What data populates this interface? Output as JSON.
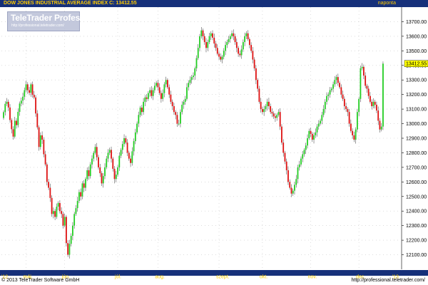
{
  "header": {
    "title": "DOW JONES INDUSTRIAL AVERAGE INDEX",
    "close_label": "C: 13412.55",
    "period": "naponta"
  },
  "logo": {
    "name": "TeleTrader Professional",
    "url": "http://professional.teletrader.com/"
  },
  "footer": {
    "copyright": "© 2013 TeleTrader Software GmbH",
    "url": "http://professional.teletrader.com/"
  },
  "colors": {
    "up": "#22cc22",
    "down": "#dd1111",
    "bar": "#16307a",
    "axis_text": "#ffcc00",
    "last_price_bg": "#ffff00"
  },
  "chart_data": {
    "type": "candlestick",
    "title": "DOW JONES INDUSTRIAL AVERAGE INDEX",
    "last_value": 13412.55,
    "last_label": "13412.55",
    "ylim": [
      12000,
      13800
    ],
    "y_ticks": [
      12100,
      12200,
      12300,
      12400,
      12500,
      12600,
      12700,
      12800,
      12900,
      13000,
      13100,
      13200,
      13300,
      13400,
      13500,
      13600,
      13700
    ],
    "y_tick_labels": [
      "12100.00",
      "12200.00",
      "12300.00",
      "12400.00",
      "12500.00",
      "12600.00",
      "12700.00",
      "12800.00",
      "12900.00",
      "13000.00",
      "13100.00",
      "13200.00",
      "13300.00",
      "13400.00",
      "13500.00",
      "13600.00",
      "13700.00"
    ],
    "x_axis_labels": [
      "'12",
      "máj.",
      "jún.",
      "júl.",
      "aug.",
      "szept.",
      "okt.",
      "nov.",
      "dec.",
      "'13"
    ],
    "x_axis_positions": [
      0,
      14,
      38,
      71,
      96,
      134,
      161,
      191,
      221,
      243
    ],
    "x_count": 248,
    "grid": "dotted",
    "close": [
      13079,
      13136,
      13150,
      13111,
      13025,
      12962,
      12911,
      13020,
      12990,
      13081,
      13138,
      13158,
      13185,
      13230,
      13270,
      13230,
      13212,
      13270,
      13198,
      13180,
      13070,
      12975,
      12840,
      12920,
      12890,
      12790,
      12720,
      12600,
      12560,
      12490,
      12380,
      12400,
      12360,
      12430,
      12455,
      12400,
      12380,
      12300,
      12360,
      12180,
      12100,
      12175,
      12230,
      12300,
      12380,
      12420,
      12470,
      12530,
      12500,
      12590,
      12560,
      12620,
      12680,
      12640,
      12720,
      12760,
      12800,
      12840,
      12770,
      12700,
      12660,
      12590,
      12640,
      12700,
      12760,
      12800,
      12820,
      12760,
      12690,
      12620,
      12650,
      12700,
      12780,
      12820,
      12860,
      12900,
      12870,
      12800,
      12760,
      12730,
      12810,
      12880,
      12940,
      13000,
      13060,
      13110,
      13080,
      13150,
      13180,
      13170,
      13210,
      13230,
      13190,
      13230,
      13260,
      13280,
      13250,
      13210,
      13170,
      13210,
      13270,
      13300,
      13250,
      13200,
      13150,
      13120,
      13080,
      13060,
      13000,
      13000,
      13080,
      13130,
      13150,
      13170,
      13250,
      13280,
      13300,
      13320,
      13330,
      13380,
      13450,
      13520,
      13600,
      13640,
      13600,
      13560,
      13520,
      13560,
      13600,
      13620,
      13590,
      13550,
      13520,
      13480,
      13460,
      13440,
      13460,
      13500,
      13540,
      13560,
      13580,
      13600,
      13620,
      13600,
      13560,
      13520,
      13480,
      13470,
      13510,
      13560,
      13600,
      13620,
      13580,
      13540,
      13500,
      13440,
      13380,
      13300,
      13240,
      13150,
      13100,
      13080,
      13100,
      13120,
      13150,
      13120,
      13080,
      13070,
      13050,
      13040,
      13060,
      13080,
      12980,
      12870,
      12800,
      12740,
      12680,
      12600,
      12560,
      12520,
      12540,
      12580,
      12620,
      12700,
      12720,
      12760,
      12790,
      12820,
      12850,
      12900,
      12950,
      12930,
      12890,
      12920,
      12940,
      12980,
      13000,
      13020,
      13060,
      13100,
      13150,
      13190,
      13200,
      13230,
      13240,
      13270,
      13300,
      13320,
      13280,
      13250,
      13200,
      13170,
      13120,
      13100,
      13080,
      13000,
      12950,
      12920,
      12890,
      12960,
      13080,
      13170,
      13380,
      13390,
      13330,
      13260,
      13240,
      13190,
      13150,
      13120,
      13150,
      13130,
      13090,
      13020,
      12960,
      12980,
      13412
    ]
  }
}
